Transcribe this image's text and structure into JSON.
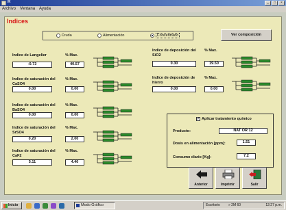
{
  "window": {
    "title": "R"
  },
  "menu": [
    "Archivo",
    "Ventana",
    "Ayuda"
  ],
  "page_title": "Indices",
  "stream_options": [
    {
      "label": "Cruda",
      "selected": false
    },
    {
      "label": "Alimentación",
      "selected": false
    },
    {
      "label": "Concentrado",
      "selected": true
    }
  ],
  "ver_composicion": "Ver composición",
  "max_label": "% Max.",
  "indices_left": [
    {
      "label": "Indice de Langelier",
      "value": "-0.73",
      "max": "40.57"
    },
    {
      "label": "Indice de saturación del CaSO4",
      "value": "0.00",
      "max": "0.00"
    },
    {
      "label": "Indice de saturación del BaSO4",
      "value": "0.00",
      "max": "0.00"
    },
    {
      "label": "Indice de saturación del SrSO4",
      "value": "0.20",
      "max": "2.00"
    },
    {
      "label": "Indice de saturación del CaF2",
      "value": "5.11",
      "max": "4.40"
    }
  ],
  "indices_right": [
    {
      "label": "Indice de deposición del SiO2",
      "value": "0.30",
      "max": "19.50"
    },
    {
      "label": "Indice de deposición de hierro",
      "value": "0.00",
      "max": "0.00"
    }
  ],
  "treatment": {
    "checkbox_label": "Aplicar tratamiento químico",
    "checked": true,
    "product_label": "Producto:",
    "product_value": "NAT OR 12",
    "dose_label": "Dosis en alimentación [ppm]:",
    "dose_value": "1.51",
    "consumption_label": "Consumo diario [Kg]:",
    "consumption_value": "7.2"
  },
  "buttons": {
    "anterior": "Anterior",
    "imprimir": "Imprimir",
    "salir": "Salir"
  },
  "taskbar": {
    "start": "Inicio",
    "task": "Modo Gráfico",
    "tray_label": "Escritorio",
    "tray_text": "» 2M 60",
    "clock": "12:27 p.m."
  },
  "colors": {
    "heading": "#d81818",
    "panel": "#ece9b8",
    "module": "#2a8a2a"
  }
}
